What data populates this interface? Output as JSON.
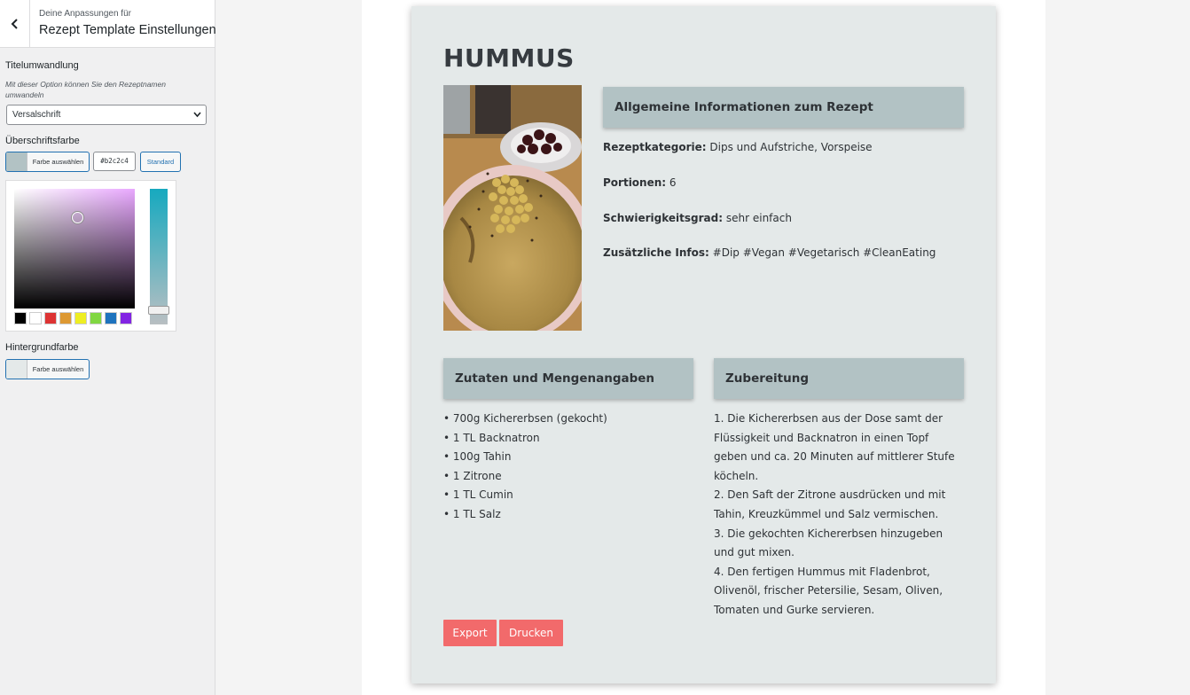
{
  "sidebar": {
    "back_icon": "chevron-left-icon",
    "header_subtitle": "Deine Anpassungen für",
    "header_title": "Rezept Template Einstellungen",
    "title_transform": {
      "label": "Titelumwandlung",
      "description": "Mit dieser Option können Sie den Rezeptnamen umwandeln",
      "selected": "Versalschrift"
    },
    "heading_color": {
      "label": "Überschriftsfarbe",
      "button_label": "Farbe auswählen",
      "color": "#b2c2c4",
      "hex_value": "#b2c2c4",
      "default_label": "Standard",
      "palette": [
        "#000000",
        "#ffffff",
        "#dd3333",
        "#dd9933",
        "#eeee22",
        "#81d742",
        "#1e73be",
        "#8224e3"
      ]
    },
    "background_color": {
      "label": "Hintergrundfarbe",
      "button_label": "Farbe auswählen",
      "color": "#e4e9e9"
    }
  },
  "recipe": {
    "title": "HUMMUS",
    "info_heading": "Allgemeine Informationen zum Rezept",
    "info": [
      {
        "label": "Rezeptkategorie:",
        "value": " Dips und Aufstriche, Vorspeise"
      },
      {
        "label": "Portionen:",
        "value": " 6"
      },
      {
        "label": "Schwierigkeitsgrad:",
        "value": " sehr einfach"
      },
      {
        "label": "Zusätzliche Infos:",
        "value": " #Dip #Vegan #Vegetarisch #CleanEating"
      }
    ],
    "ingredients_heading": "Zutaten und Mengenangaben",
    "ingredients": [
      "• 700g Kichererbsen (gekocht)",
      "• 1 TL Backnatron",
      "• 100g Tahin",
      "• 1 Zitrone",
      "• 1 TL Cumin",
      "• 1 TL Salz"
    ],
    "preparation_heading": "Zubereitung",
    "preparation": "1. Die Kichererbsen aus der Dose samt der Flüssigkeit und Backnatron in einen Topf geben und ca. 20 Minuten auf mittlerer Stufe köcheln.\n2. Den Saft der Zitrone ausdrücken und mit Tahin, Kreuzkümmel und Salz vermischen.\n3. Die gekochten Kichererbsen hinzugeben und gut mixen.\n4. Den fertigen Hummus mit Fladenbrot, Olivenöl, frischer Petersilie, Sesam, Oliven, Tomaten und Gurke servieren.",
    "export_label": "Export",
    "print_label": "Drucken",
    "button_color": "#f26a6b"
  }
}
